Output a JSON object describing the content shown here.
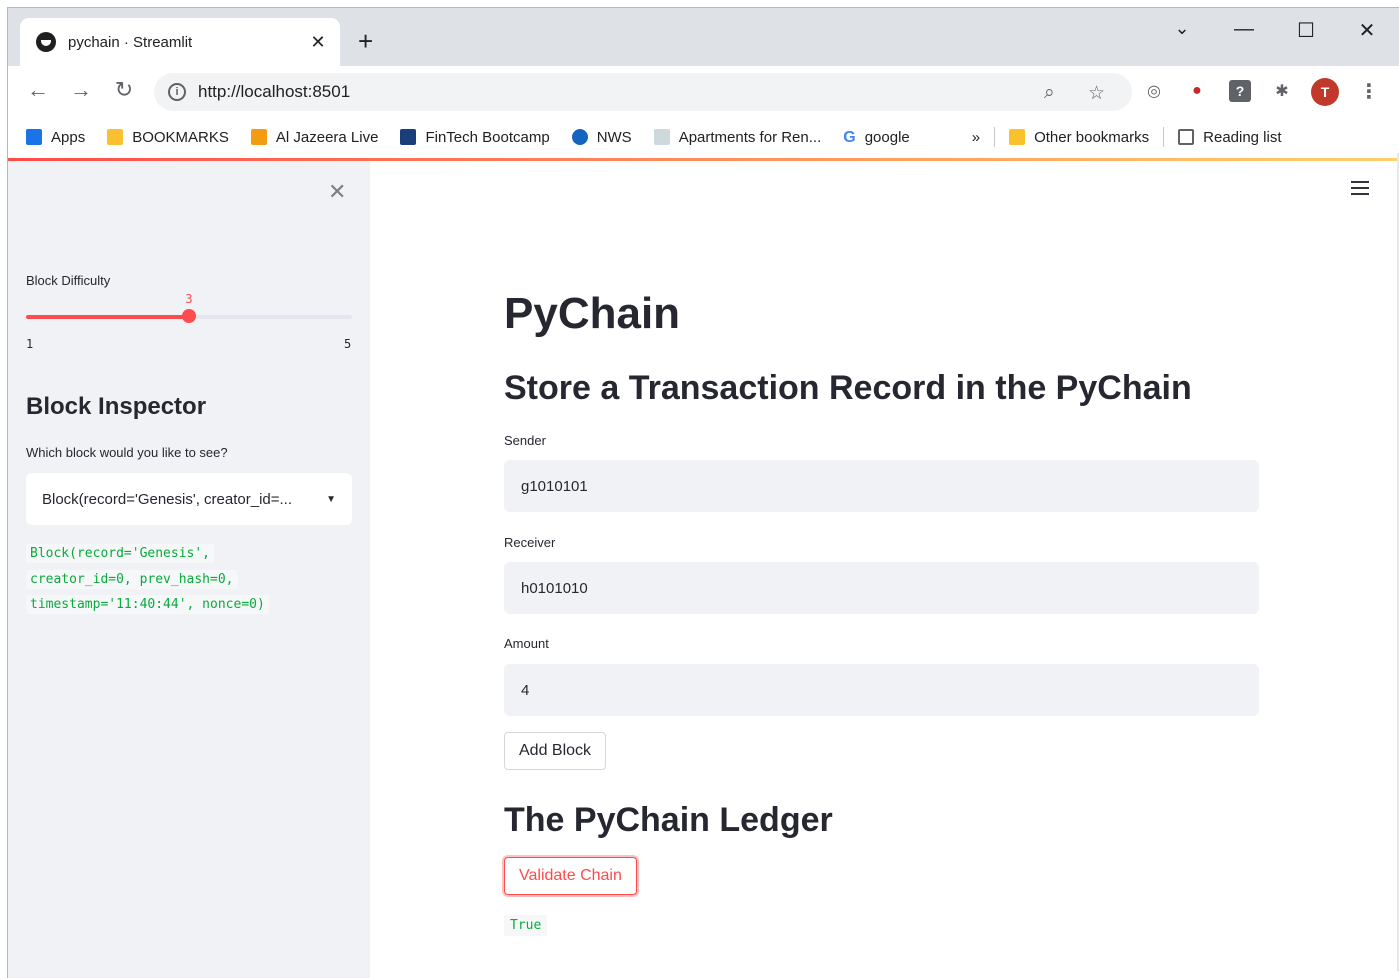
{
  "browser": {
    "tab_title": "pychain · Streamlit",
    "tab_close": "✕",
    "new_tab": "+",
    "url": "http://localhost:8501",
    "avatar_letter": "T",
    "window_controls": {
      "minimize": "—",
      "maximize": "☐",
      "close": "✕",
      "tab_search": "⌄"
    }
  },
  "bookmarks": [
    {
      "label": "Apps",
      "icon": "apps-grid-icon",
      "color": "#1a73e8"
    },
    {
      "label": "BOOKMARKS",
      "icon": "folder-icon",
      "color": "#fbc02d"
    },
    {
      "label": "Al Jazeera Live",
      "icon": "aljazeera-icon",
      "color": "#f39c12"
    },
    {
      "label": "FinTech Bootcamp",
      "icon": "fintech-icon",
      "color": "#1a3d7c"
    },
    {
      "label": "NWS",
      "icon": "nws-icon",
      "color": "#1565c0"
    },
    {
      "label": "Apartments for Ren...",
      "icon": "apartments-icon",
      "color": "#cfd8dc"
    },
    {
      "label": "google",
      "icon": "google-icon",
      "color": "#4285f4"
    }
  ],
  "bookmarks_more": "»",
  "bookmarks_right": [
    {
      "label": "Other bookmarks",
      "icon": "folder-icon",
      "color": "#fbc02d"
    },
    {
      "label": "Reading list",
      "icon": "reading-list-icon",
      "color": "#5f6368"
    }
  ],
  "sidebar": {
    "close": "✕",
    "slider": {
      "label": "Block Difficulty",
      "min": 1,
      "max": 5,
      "value": 3,
      "min_label": "1",
      "max_label": "5",
      "value_label": "3"
    },
    "heading": "Block Inspector",
    "select_label": "Which block would you like to see?",
    "select_value": "Block(record='Genesis', creator_id=0, prev_hash=0, timestamp='11:40:44', nonce=0)",
    "select_display": "Block(record='Genesis', creator_id=...",
    "code_lines": [
      "Block(record='Genesis',",
      "creator_id=0, prev_hash=0,",
      "timestamp='11:40:44', nonce=0)"
    ]
  },
  "main": {
    "title": "PyChain",
    "store_heading": "Store a Transaction Record in the PyChain",
    "sender_label": "Sender",
    "sender_value": "g1010101",
    "receiver_label": "Receiver",
    "receiver_value": "h0101010",
    "amount_label": "Amount",
    "amount_value": "4",
    "add_block_label": "Add Block",
    "ledger_heading": "The PyChain Ledger",
    "validate_label": "Validate Chain",
    "validation_result": "True"
  },
  "colors": {
    "accent": "#ff4b4b",
    "code_green": "#09ab3b",
    "sidebar_bg": "#f0f2f6"
  }
}
